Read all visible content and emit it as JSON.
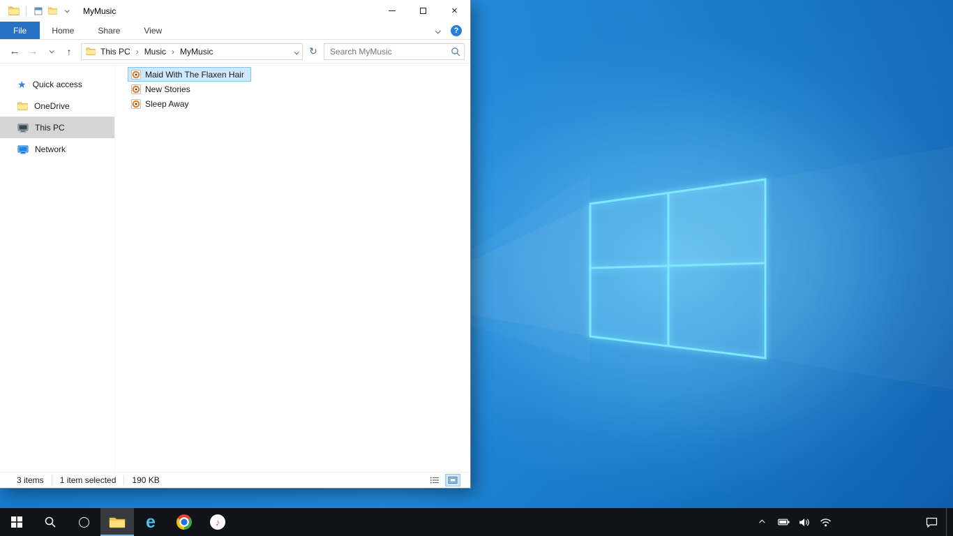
{
  "explorer": {
    "title": "MyMusic",
    "ribbon": {
      "file_tab": "File",
      "tabs": [
        "Home",
        "Share",
        "View"
      ]
    },
    "navbar": {
      "breadcrumb": [
        "This PC",
        "Music",
        "MyMusic"
      ],
      "search_placeholder": "Search MyMusic"
    },
    "sidebar": [
      {
        "label": "Quick access",
        "icon": "star",
        "selected": false
      },
      {
        "label": "OneDrive",
        "icon": "folder",
        "selected": false
      },
      {
        "label": "This PC",
        "icon": "computer",
        "selected": true
      },
      {
        "label": "Network",
        "icon": "network",
        "selected": false
      }
    ],
    "files": [
      {
        "name": "Maid With The Flaxen Hair",
        "type": "music",
        "selected": true
      },
      {
        "name": "New Stories",
        "type": "music",
        "selected": false
      },
      {
        "name": "Sleep Away",
        "type": "music",
        "selected": false
      }
    ],
    "statusbar": {
      "count": "3 items",
      "selected": "1 item selected",
      "size": "190 KB"
    }
  },
  "taskbar": {
    "buttons": [
      "start",
      "search",
      "cortana",
      "file-explorer",
      "internet-explorer",
      "chrome",
      "itunes"
    ],
    "tray": [
      "show-hidden-icons",
      "battery",
      "volume",
      "network",
      "action-center"
    ],
    "explorer_active": true
  },
  "icons": {
    "back": "←",
    "forward": "→",
    "up": "↑",
    "refresh": "↻",
    "help": "?",
    "close": "×",
    "crumb_sep": "›",
    "star": "★",
    "ie_letter": "e",
    "music_note": "♪"
  },
  "colors": {
    "file_tab_blue": "#2572c4",
    "selection_fill": "#cde8ff",
    "selection_border": "#84c5f0",
    "sidebar_selected": "#d5d5d5",
    "taskbar_bg": "#101418",
    "logo_glow": "#7de8ff",
    "wallpaper_base": "#1172c5"
  }
}
